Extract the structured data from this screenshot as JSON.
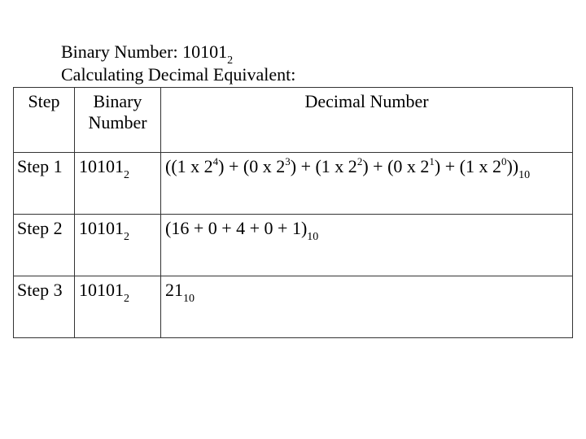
{
  "heading": {
    "binary_label": "Binary Number: ",
    "binary_value": "10101",
    "binary_base": "2",
    "calc_label": "Calculating Decimal Equivalent:"
  },
  "table": {
    "headers": [
      "Step",
      "Binary Number",
      "Decimal Number"
    ],
    "header_binary_line1": "Binary",
    "header_binary_line2": "Number",
    "rows": [
      {
        "step": "Step 1",
        "binary": "10101",
        "binary_base": "2",
        "terms": [
          {
            "coef": "1",
            "exp": "4"
          },
          {
            "coef": "0",
            "exp": "3"
          },
          {
            "coef": "1",
            "exp": "2"
          },
          {
            "coef": "0",
            "exp": "1"
          },
          {
            "coef": "1",
            "exp": "0"
          }
        ],
        "decimal_base": "10"
      },
      {
        "step": "Step 2",
        "binary": "10101",
        "binary_base": "2",
        "decimal": "(16 + 0 + 4 + 0 + 1)",
        "decimal_base": "10"
      },
      {
        "step": "Step 3",
        "binary": "10101",
        "binary_base": "2",
        "decimal": "21",
        "decimal_base": "10"
      }
    ]
  }
}
